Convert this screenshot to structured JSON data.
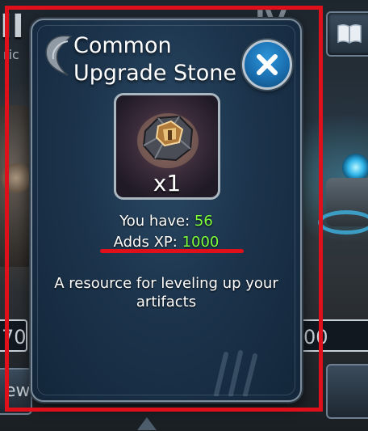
{
  "background": {
    "left_title": "II",
    "left_subtitle": "ric",
    "numeral": "IV",
    "left_field_value": "70",
    "right_field_value": "00",
    "left_button_label": "ew",
    "book_icon": "book-icon"
  },
  "popup": {
    "title": "Common Upgrade Stone",
    "close_icon": "close-x-icon",
    "item_icon": "upgrade-stone-icon",
    "quantity": "x1",
    "you_have_label": "You have:",
    "you_have_value": "56",
    "adds_xp_label": "Adds XP:",
    "adds_xp_value": "1000",
    "description": "A resource for leveling up your artifacts"
  },
  "colors": {
    "accent_green": "#7dff3a",
    "close_button_blue": "#1a6fb0",
    "annotation_red": "#e0101a",
    "popup_bg": "#1c344c"
  }
}
